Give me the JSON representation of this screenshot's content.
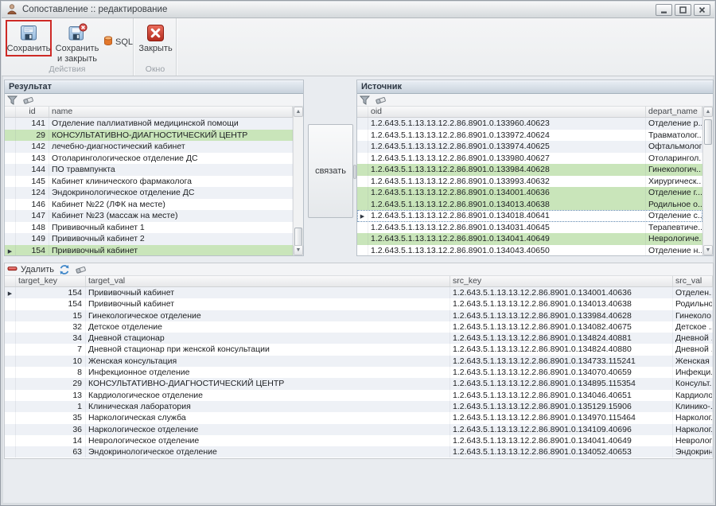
{
  "window": {
    "title": "Сопоставление :: редактирование"
  },
  "ribbon": {
    "save": "Сохранить",
    "save_close_line1": "Сохранить",
    "save_close_line2": "и закрыть",
    "sql": "SQL",
    "close": "Закрыть",
    "group_actions": "Действия",
    "group_window": "Окно"
  },
  "link_button": {
    "label": "связать"
  },
  "result_panel": {
    "title": "Результат",
    "columns": [
      "id",
      "name"
    ],
    "rows": [
      {
        "id": "141",
        "name": "Отделение паллиативной медицинской помощи"
      },
      {
        "id": "29",
        "name": "КОНСУЛЬТАТИВНО-ДИАГНОСТИЧЕСКИЙ ЦЕНТР",
        "green": true
      },
      {
        "id": "142",
        "name": "лечебно-диагностический кабинет"
      },
      {
        "id": "143",
        "name": "Отоларингологическое отделение ДС"
      },
      {
        "id": "144",
        "name": "ПО травмпункта"
      },
      {
        "id": "145",
        "name": "Кабинет клинического фармаколога"
      },
      {
        "id": "124",
        "name": "Эндокринологическое отделение ДС"
      },
      {
        "id": "146",
        "name": "Кабинет №22 (ЛФК на месте)"
      },
      {
        "id": "147",
        "name": "Кабинет №23 (массаж на месте)"
      },
      {
        "id": "148",
        "name": "Прививочный кабинет 1"
      },
      {
        "id": "149",
        "name": "Прививочный кабинет 2"
      },
      {
        "id": "154",
        "name": "Прививочный кабинет",
        "green": true,
        "focused": true
      }
    ]
  },
  "source_panel": {
    "title": "Источник",
    "columns": [
      "oid",
      "depart_name"
    ],
    "rows": [
      {
        "oid": "1.2.643.5.1.13.13.12.2.86.8901.0.133960.40623",
        "depart_name": "Отделение р..."
      },
      {
        "oid": "1.2.643.5.1.13.13.12.2.86.8901.0.133972.40624",
        "depart_name": "Травматолог..."
      },
      {
        "oid": "1.2.643.5.1.13.13.12.2.86.8901.0.133974.40625",
        "depart_name": "Офтальмолог..."
      },
      {
        "oid": "1.2.643.5.1.13.13.12.2.86.8901.0.133980.40627",
        "depart_name": "Отоларингол..."
      },
      {
        "oid": "1.2.643.5.1.13.13.12.2.86.8901.0.133984.40628",
        "depart_name": "Гинекологич...",
        "green": true
      },
      {
        "oid": "1.2.643.5.1.13.13.12.2.86.8901.0.133993.40632",
        "depart_name": "Хирургическ..."
      },
      {
        "oid": "1.2.643.5.1.13.13.12.2.86.8901.0.134001.40636",
        "depart_name": "Отделение г...",
        "green": true
      },
      {
        "oid": "1.2.643.5.1.13.13.12.2.86.8901.0.134013.40638",
        "depart_name": "Родильное о...",
        "green": true
      },
      {
        "oid": "1.2.643.5.1.13.13.12.2.86.8901.0.134018.40641",
        "depart_name": "Отделение с...",
        "focused": true
      },
      {
        "oid": "1.2.643.5.1.13.13.12.2.86.8901.0.134031.40645",
        "depart_name": "Терапевтиче..."
      },
      {
        "oid": "1.2.643.5.1.13.13.12.2.86.8901.0.134041.40649",
        "depart_name": "Неврологиче...",
        "green": true
      },
      {
        "oid": "1.2.643.5.1.13.13.12.2.86.8901.0.134043.40650",
        "depart_name": "Отделение н..."
      }
    ]
  },
  "mapping_panel": {
    "delete_label": "Удалить",
    "columns": [
      "target_key",
      "target_val",
      "src_key",
      "src_val"
    ],
    "rows": [
      {
        "target_key": "154",
        "target_val": "Прививочный кабинет",
        "src_key": "1.2.643.5.1.13.13.12.2.86.8901.0.134001.40636",
        "src_val": "Отделен...",
        "focused": true
      },
      {
        "target_key": "154",
        "target_val": "Прививочный кабинет",
        "src_key": "1.2.643.5.1.13.13.12.2.86.8901.0.134013.40638",
        "src_val": "Родильно..."
      },
      {
        "target_key": "15",
        "target_val": "Гинекологическое отделение",
        "src_key": "1.2.643.5.1.13.13.12.2.86.8901.0.133984.40628",
        "src_val": "Гинеколо..."
      },
      {
        "target_key": "32",
        "target_val": "Детское отделение",
        "src_key": "1.2.643.5.1.13.13.12.2.86.8901.0.134082.40675",
        "src_val": "Детское ..."
      },
      {
        "target_key": "34",
        "target_val": "Дневной стационар",
        "src_key": "1.2.643.5.1.13.13.12.2.86.8901.0.134824.40881",
        "src_val": "Дневной ..."
      },
      {
        "target_key": "7",
        "target_val": "Дневной стационар при женской консультации",
        "src_key": "1.2.643.5.1.13.13.12.2.86.8901.0.134824.40880",
        "src_val": "Дневной ..."
      },
      {
        "target_key": "10",
        "target_val": "Женская консультация",
        "src_key": "1.2.643.5.1.13.13.12.2.86.8901.0.134733.115241",
        "src_val": "Женская ..."
      },
      {
        "target_key": "8",
        "target_val": "Инфекционное отделение",
        "src_key": "1.2.643.5.1.13.13.12.2.86.8901.0.134070.40659",
        "src_val": "Инфекци..."
      },
      {
        "target_key": "29",
        "target_val": "КОНСУЛЬТАТИВНО-ДИАГНОСТИЧЕСКИЙ ЦЕНТР",
        "src_key": "1.2.643.5.1.13.13.12.2.86.8901.0.134895.115354",
        "src_val": "Консульт..."
      },
      {
        "target_key": "13",
        "target_val": "Кардиологическое отделение",
        "src_key": "1.2.643.5.1.13.13.12.2.86.8901.0.134046.40651",
        "src_val": "Кардиоло..."
      },
      {
        "target_key": "1",
        "target_val": "Клиническая лаборатория",
        "src_key": "1.2.643.5.1.13.13.12.2.86.8901.0.135129.15906",
        "src_val": "Клинико-..."
      },
      {
        "target_key": "35",
        "target_val": "Наркологическая служба",
        "src_key": "1.2.643.5.1.13.13.12.2.86.8901.0.134970.115464",
        "src_val": "Нарколог..."
      },
      {
        "target_key": "36",
        "target_val": "Наркологическое отделение",
        "src_key": "1.2.643.5.1.13.13.12.2.86.8901.0.134109.40696",
        "src_val": "Нарколог..."
      },
      {
        "target_key": "14",
        "target_val": "Неврологическое отделение",
        "src_key": "1.2.643.5.1.13.13.12.2.86.8901.0.134041.40649",
        "src_val": "Невролог..."
      },
      {
        "target_key": "63",
        "target_val": "Эндокринологическое отделение",
        "src_key": "1.2.643.5.1.13.13.12.2.86.8901.0.134052.40653",
        "src_val": "Эндокрин..."
      }
    ]
  },
  "colors": {
    "match_green": "#c9e5ba",
    "alt_row": "#eef1f6",
    "annotation_red": "#ce2a26"
  }
}
